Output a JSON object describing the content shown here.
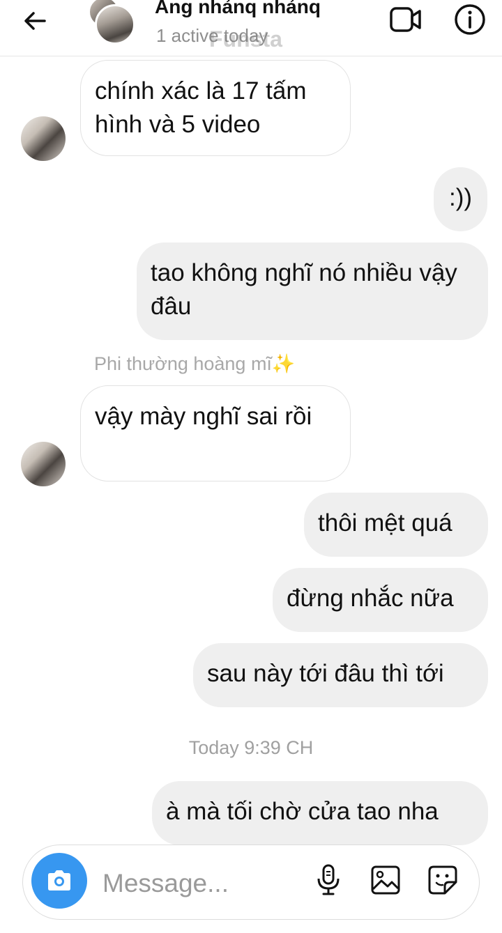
{
  "header": {
    "contact_name": "Ảng nhảnq nhảnq",
    "status": "1 active today",
    "watermark": "Funsta"
  },
  "messages": [
    {
      "side": "in",
      "text": "chính xác là 17 tấm hình và 5 video"
    },
    {
      "side": "out",
      "text": ":))"
    },
    {
      "side": "out",
      "text": "tao không nghĩ nó nhiều vậy đâu"
    },
    {
      "side": "in",
      "sender": "Phi thường hoàng mĩ✨",
      "text": "vậy mày nghĩ sai rồi"
    },
    {
      "side": "out",
      "text": "thôi mệt quá"
    },
    {
      "side": "out",
      "text": "đừng nhắc nữa"
    },
    {
      "side": "out",
      "text": "sau này tới đâu thì tới"
    },
    {
      "side": "out",
      "text": "à mà tối chờ cửa tao nha"
    }
  ],
  "timestamp": "Today 9:39 CH",
  "composer": {
    "placeholder": "Message..."
  },
  "icons": {
    "back": "back-arrow-icon",
    "video": "video-call-icon",
    "info": "info-icon",
    "camera": "camera-icon",
    "mic": "microphone-icon",
    "gallery": "gallery-icon",
    "sticker": "sticker-icon"
  },
  "colors": {
    "accent": "#3797f0",
    "outgoing_bubble": "#efefef"
  }
}
